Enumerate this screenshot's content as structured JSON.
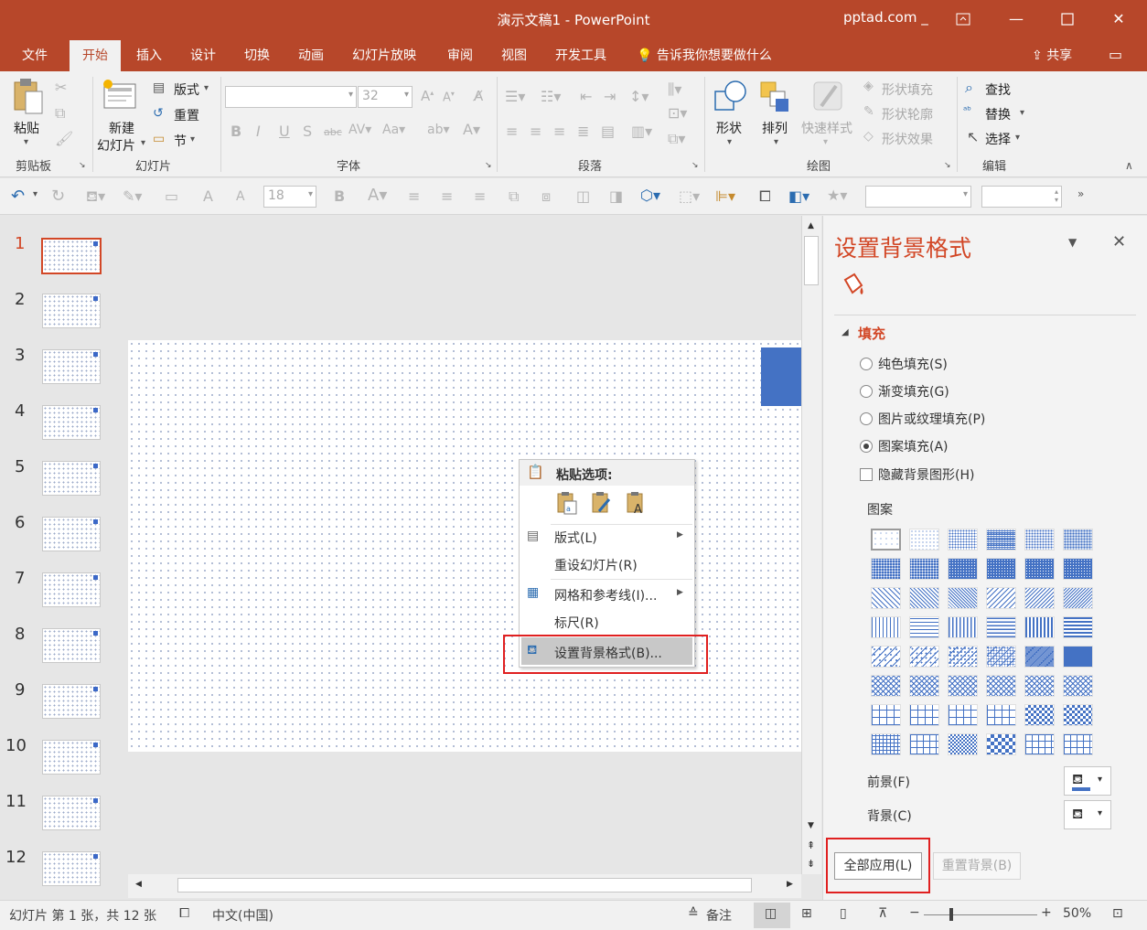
{
  "window": {
    "title": "演示文稿1  -  PowerPoint",
    "account": "pptad.com _",
    "controls": [
      "restore-ribbon",
      "minimize",
      "maximize",
      "close"
    ]
  },
  "tabs": [
    "文件",
    "开始",
    "插入",
    "设计",
    "切换",
    "动画",
    "幻灯片放映",
    "审阅",
    "视图",
    "开发工具"
  ],
  "active_tab": "开始",
  "tell_me": "告诉我你想要做什么",
  "share": "共享",
  "ribbon": {
    "clipboard": {
      "paste": "粘贴",
      "label": "剪贴板"
    },
    "slides": {
      "new_slide_1": "新建",
      "new_slide_2": "幻灯片",
      "layout": "版式",
      "reset": "重置",
      "section": "节",
      "label": "幻灯片"
    },
    "font": {
      "font_size": "32",
      "label": "字体"
    },
    "paragraph": {
      "label": "段落"
    },
    "drawing": {
      "shapes": "形状",
      "arrange": "排列",
      "quick_styles": "快速样式",
      "shape_fill": "形状填充",
      "shape_outline": "形状轮廓",
      "shape_effects": "形状效果",
      "label": "绘图"
    },
    "editing": {
      "find": "查找",
      "replace": "替换",
      "select": "选择",
      "label": "编辑"
    }
  },
  "qat": {
    "font_size": "18"
  },
  "thumbnails": [
    "1",
    "2",
    "3",
    "4",
    "5",
    "6",
    "7",
    "8",
    "9",
    "10",
    "11",
    "12"
  ],
  "context_menu": {
    "paste_header": "粘贴选项:",
    "layout": "版式(L)",
    "reset_slide": "重设幻灯片(R)",
    "grid": "网格和参考线(I)...",
    "ruler": "标尺(R)",
    "format_bg": "设置背景格式(B)..."
  },
  "pane": {
    "title": "设置背景格式",
    "section": "填充",
    "options": [
      "纯色填充(S)",
      "渐变填充(G)",
      "图片或纹理填充(P)",
      "图案填充(A)"
    ],
    "selected_option": "图案填充(A)",
    "hide_bg": "隐藏背景图形(H)",
    "pattern_label": "图案",
    "foreground": "前景(F)",
    "background": "背景(C)",
    "apply_all": "全部应用(L)",
    "reset_bg": "重置背景(B)",
    "accent": "#4472c4"
  },
  "status": {
    "slide_info": "幻灯片 第 1 张，共 12 张",
    "language": "中文(中国)",
    "notes": "备注",
    "zoom": "50%"
  }
}
